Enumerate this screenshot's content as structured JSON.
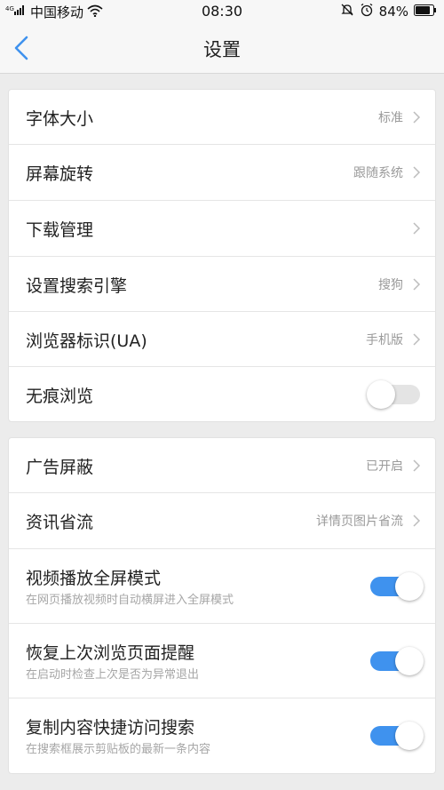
{
  "status_bar": {
    "signal_text": "4G",
    "carrier": "中国移动",
    "time": "08:30",
    "battery": "84%"
  },
  "nav": {
    "title": "设置"
  },
  "group1": {
    "rows": [
      {
        "label": "字体大小",
        "value": "标准"
      },
      {
        "label": "屏幕旋转",
        "value": "跟随系统"
      },
      {
        "label": "下载管理",
        "value": ""
      },
      {
        "label": "设置搜索引擎",
        "value": "搜狗"
      },
      {
        "label": "浏览器标识(UA)",
        "value": "手机版"
      },
      {
        "label": "无痕浏览",
        "toggle": false
      }
    ]
  },
  "group2": {
    "rows": [
      {
        "label": "广告屏蔽",
        "value": "已开启"
      },
      {
        "label": "资讯省流",
        "value": "详情页图片省流"
      },
      {
        "label": "视频播放全屏模式",
        "sub": "在网页播放视频时自动横屏进入全屏模式",
        "toggle": true
      },
      {
        "label": "恢复上次浏览页面提醒",
        "sub": "在启动时检查上次是否为异常退出",
        "toggle": true
      },
      {
        "label": "复制内容快捷访问搜索",
        "sub": "在搜索框展示剪贴板的最新一条内容",
        "toggle": true
      }
    ]
  },
  "colors": {
    "accent": "#3f92ee",
    "background": "#ececec",
    "toggle_off": "#e4e4e4"
  },
  "icons": [
    "signal-icon",
    "wifi-icon",
    "mute-bell-icon",
    "alarm-icon",
    "battery-icon",
    "back-arrow-icon",
    "chevron-right-icon"
  ]
}
